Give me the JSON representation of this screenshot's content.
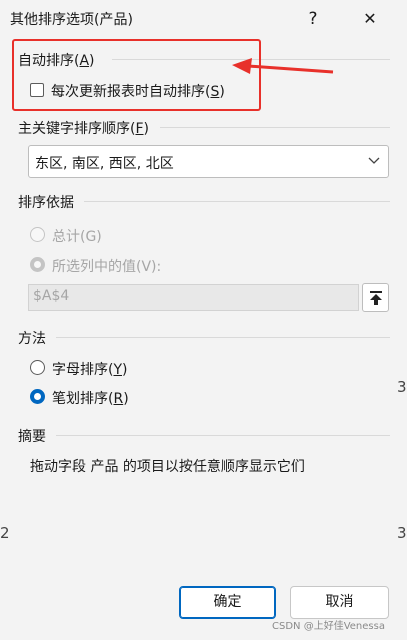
{
  "window": {
    "title": "其他排序选项(产品)",
    "help_label": "?",
    "close_label": "✕"
  },
  "auto_sort": {
    "section_label": "自动排序(",
    "section_key": "A",
    "section_suffix": ")",
    "checkbox_label": "每次更新报表时自动排序(",
    "checkbox_key": "S",
    "checkbox_suffix": ")",
    "checked": false
  },
  "primary_key": {
    "label": "主关键字排序顺序(",
    "label_key": "F",
    "label_suffix": ")",
    "selected": "东区, 南区, 西区, 北区"
  },
  "sort_by": {
    "label": "排序依据",
    "option_total": "总计(G)",
    "option_selected_column": "所选列中的值(V):",
    "reference": "$A$4"
  },
  "method": {
    "label": "方法",
    "option_alpha_label": "字母排序(",
    "option_alpha_key": "Y",
    "option_alpha_suffix": ")",
    "option_stroke_label": "笔划排序(",
    "option_stroke_key": "R",
    "option_stroke_suffix": ")",
    "selected": "笔划排序"
  },
  "summary": {
    "label": "摘要",
    "text": "拖动字段 产品 的项目以按任意顺序显示它们"
  },
  "buttons": {
    "ok": "确定",
    "cancel": "取消"
  },
  "watermark": "CSDN @上好佳Venessa",
  "background_edge": {
    "mark1": "3",
    "mark2": "2",
    "mark3": "3"
  },
  "annotation": {
    "highlight_color": "#e8302a"
  }
}
